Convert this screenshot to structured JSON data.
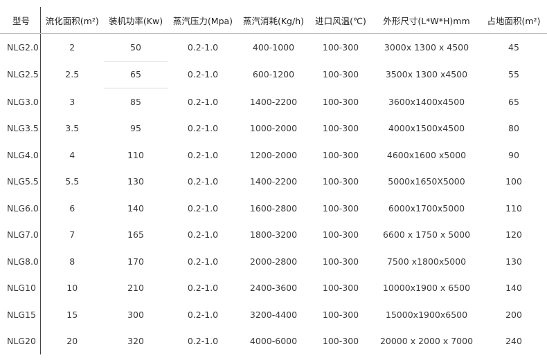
{
  "headers": [
    "型号",
    "流化面积(m²)",
    "装机功率(Kw)",
    "蒸汽压力(Mpa)",
    "蒸汽消耗(Kg/h)",
    "进口风温(℃)",
    "外形尺寸(L*W*H)mm",
    "占地面积(m²)"
  ],
  "rows": [
    [
      "NLG2.0",
      "2",
      "50",
      "0.2-1.0",
      "400-1000",
      "100-300",
      "3000x 1300 x 4500",
      "45"
    ],
    [
      "NLG2.5",
      "2.5",
      "65",
      "0.2-1.0",
      "600-1200",
      "100-300",
      "3500x 1300 x4500",
      "55"
    ],
    [
      "NLG3.0",
      "3",
      "85",
      "0.2-1.0",
      "1400-2200",
      "100-300",
      "3600x1400x4500",
      "65"
    ],
    [
      "NLG3.5",
      "3.5",
      "95",
      "0.2-1.0",
      "1000-2000",
      "100-300",
      "4000x1500x4500",
      "80"
    ],
    [
      "NLG4.0",
      "4",
      "110",
      "0.2-1.0",
      "1200-2000",
      "100-300",
      "4600x1600 x5000",
      "90"
    ],
    [
      "NLG5.5",
      "5.5",
      "130",
      "0.2-1.0",
      "1400-2200",
      "100-300",
      "5000x1650X5000",
      "100"
    ],
    [
      "NLG6.0",
      "6",
      "140",
      "0.2-1.0",
      "1600-2800",
      "100-300",
      "6000x1700x5000",
      "110"
    ],
    [
      "NLG7.0",
      "7",
      "165",
      "0.2-1.0",
      "1800-3200",
      "100-300",
      "6600 x 1750 x 5000",
      "120"
    ],
    [
      "NLG8.0",
      "8",
      "170",
      "0.2-1.0",
      "2000-2800",
      "100-300",
      "7500 x1800x5000",
      "130"
    ],
    [
      "NLG10",
      "10",
      "210",
      "0.2-1.0",
      "2400-3600",
      "100-300",
      "10000x1900 x 6500",
      "140"
    ],
    [
      "NLG15",
      "15",
      "300",
      "0.2-1.0",
      "3200-4400",
      "100-300",
      "15000x1900x6500",
      "200"
    ],
    [
      "NLG20",
      "20",
      "320",
      "0.2-1.0",
      "4000-6000",
      "100-300",
      "20000 x 2000 x 7000",
      "240"
    ]
  ]
}
